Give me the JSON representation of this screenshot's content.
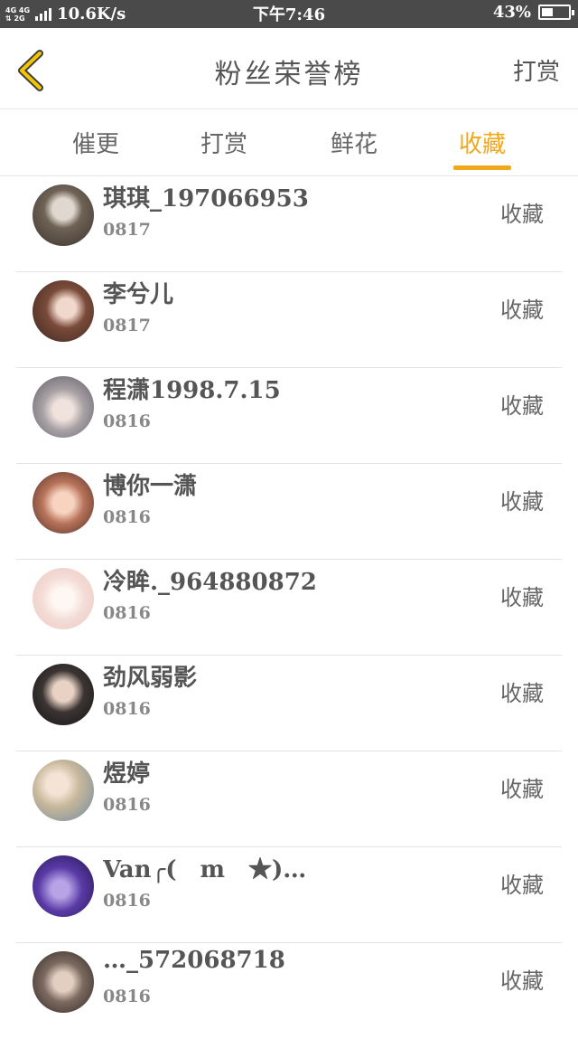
{
  "status_bar": {
    "network_top": "4G 4G",
    "network_bottom": "⇅ 2G",
    "speed": "10.6K/s",
    "time": "下午7:46",
    "battery_percent": "43%",
    "battery_level": 0.43
  },
  "header": {
    "title": "粉丝荣誉榜",
    "right_action": "打赏",
    "back_icon": "chevron-left-icon",
    "accent_color": "#f0a81a"
  },
  "tabs": [
    {
      "label": "催更",
      "active": false
    },
    {
      "label": "打赏",
      "active": false
    },
    {
      "label": "鲜花",
      "active": false
    },
    {
      "label": "收藏",
      "active": true
    }
  ],
  "fans": [
    {
      "name": "琪琪_197066953",
      "date": "0817",
      "action": "收藏"
    },
    {
      "name": "李兮儿",
      "date": "0817",
      "action": "收藏"
    },
    {
      "name": "程潇1998.7.15",
      "date": "0816",
      "action": "收藏"
    },
    {
      "name": "博你一潇",
      "date": "0816",
      "action": "收藏"
    },
    {
      "name": "冷眸._964880872",
      "date": "0816",
      "action": "收藏"
    },
    {
      "name": "劲风弱影",
      "date": "0816",
      "action": "收藏"
    },
    {
      "name": "煜婷",
      "date": "0816",
      "action": "收藏"
    },
    {
      "name": "Van╭(　m　★)…",
      "date": "0816",
      "action": "收藏"
    },
    {
      "name": "…_572068718",
      "date": "0816",
      "action": "收藏"
    }
  ]
}
